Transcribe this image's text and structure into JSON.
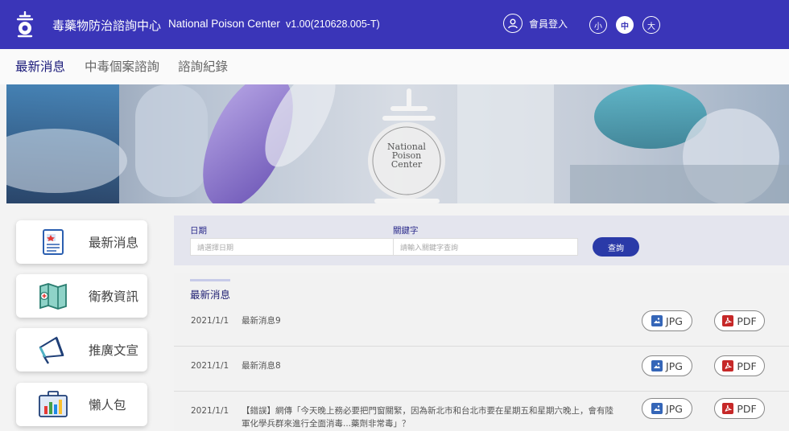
{
  "header": {
    "site_name": "毒藥物防治諮詢中心",
    "site_name_en": "National Poison Center",
    "version": "v1.00(210628.005-T)",
    "login_label": "會員登入",
    "font_sizes": [
      "小",
      "中",
      "大"
    ],
    "active_font_size": "中"
  },
  "tabs": [
    "最新消息",
    "中毒個案諮詢",
    "諮詢紀錄"
  ],
  "active_tab": "最新消息",
  "hero": {
    "logo_lines": [
      "National",
      "Poison",
      "Center"
    ]
  },
  "sidebar": {
    "items": [
      {
        "label": "最新消息",
        "icon": "news-document-icon"
      },
      {
        "label": "衛教資訊",
        "icon": "health-map-icon"
      },
      {
        "label": "推廣文宣",
        "icon": "megaphone-icon"
      },
      {
        "label": "懶人包",
        "icon": "chart-package-icon"
      }
    ]
  },
  "filter": {
    "date_label": "日期",
    "date_placeholder": "請選擇日期",
    "keyword_label": "關鍵字",
    "keyword_placeholder": "請輸入關鍵字查詢",
    "search_label": "查詢"
  },
  "news": {
    "title": "最新消息",
    "items": [
      {
        "date": "2021/1/1",
        "title": "最新消息9"
      },
      {
        "date": "2021/1/1",
        "title": "最新消息8"
      },
      {
        "date": "2021/1/1",
        "title": "【錯誤】網傳「今天晚上務必要把門窗關緊，因為新北市和台北市要在星期五和星期六晚上，會有陸軍化學兵群來進行全面消毒...藥劑非常毒」？"
      }
    ],
    "jpg_label": "JPG",
    "pdf_label": "PDF"
  },
  "colors": {
    "header_bg": "#3a35b8",
    "accent": "#2a3aa8",
    "pdf_red": "#c62828",
    "jpg_blue": "#3566b8"
  }
}
